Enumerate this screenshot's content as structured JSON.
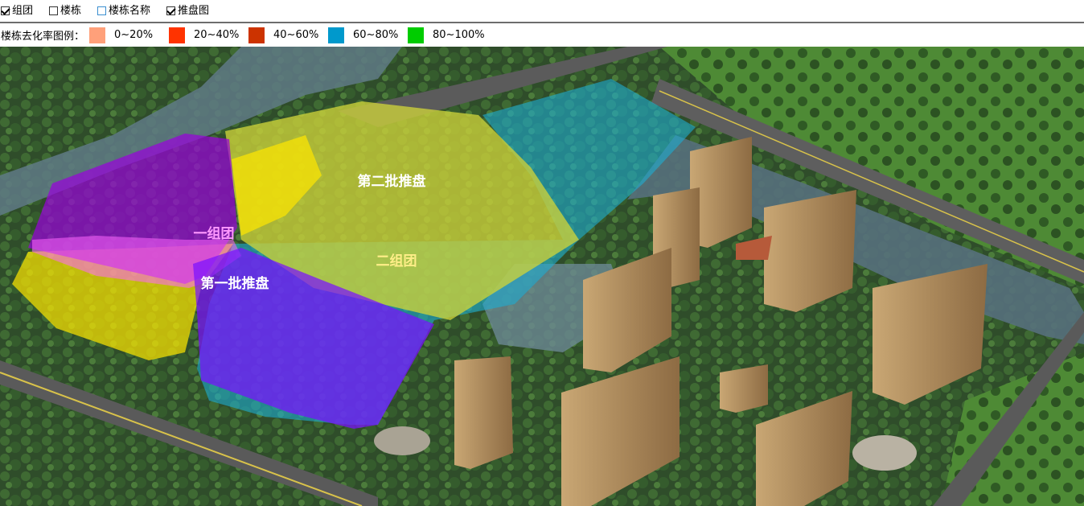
{
  "toolbar": {
    "options": [
      {
        "label": "组团",
        "checked": true
      },
      {
        "label": "楼栋",
        "checked": false
      },
      {
        "label": "楼栋名称",
        "checked": false
      },
      {
        "label": "推盘图",
        "checked": true
      }
    ]
  },
  "legend": {
    "title": "楼栋去化率图例：",
    "items": [
      {
        "label": "0~20%",
        "color": "#ffa07a"
      },
      {
        "label": "20~40%",
        "color": "#ff3300"
      },
      {
        "label": "40~60%",
        "color": "#cc3300"
      },
      {
        "label": "60~80%",
        "color": "#0099cc"
      },
      {
        "label": "80~100%",
        "color": "#00cc00"
      }
    ]
  },
  "map": {
    "labels": {
      "group_one": "一组团",
      "group_two": "二组团",
      "batch_one": "第一批推盘",
      "batch_two": "第二批推盘"
    },
    "colors": {
      "group_one": "#cc22ff",
      "group_two": "#ffe700",
      "batch_one": "#7a10ff",
      "batch_two": "#cdd23a",
      "teal_zone": "#1eaed2"
    }
  }
}
